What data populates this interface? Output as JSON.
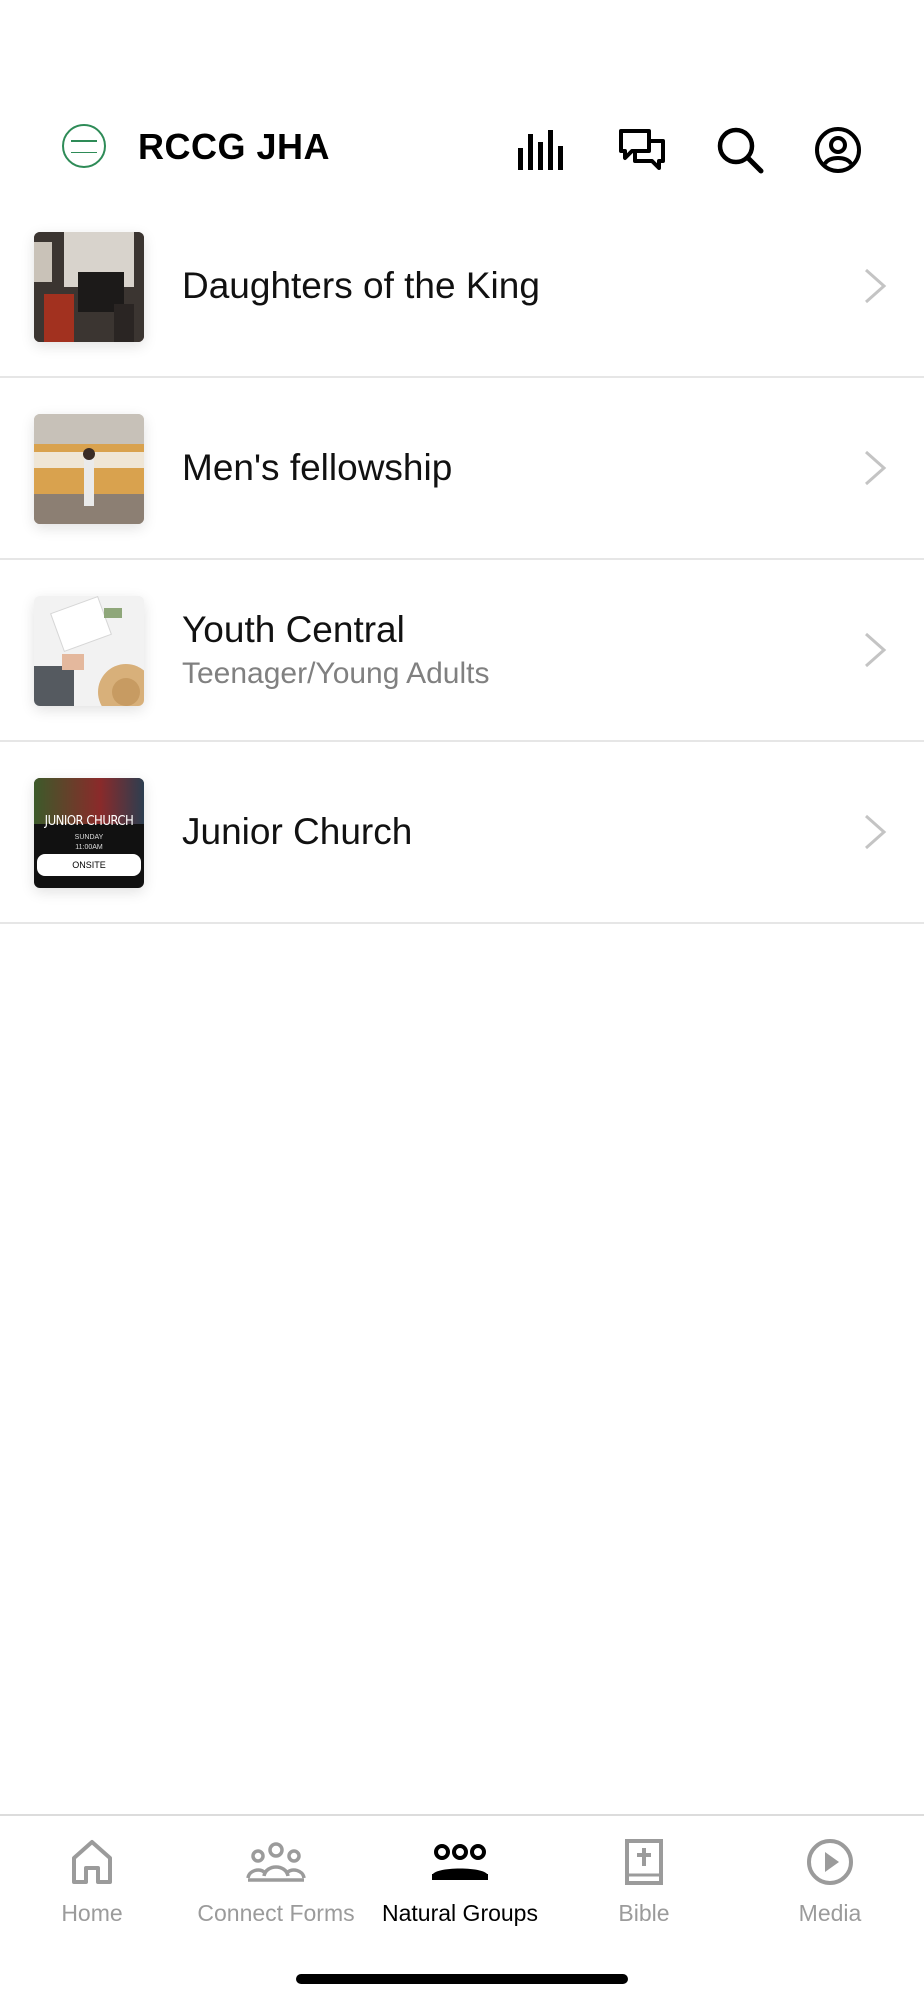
{
  "header": {
    "title": "RCCG JHA",
    "icons": [
      "chart-bars-icon",
      "chat-bubbles-icon",
      "search-icon",
      "profile-icon"
    ]
  },
  "groups": [
    {
      "title": "Daughters of the King",
      "subtitle": ""
    },
    {
      "title": "Men's fellowship",
      "subtitle": ""
    },
    {
      "title": "Youth Central",
      "subtitle": "Teenager/Young Adults"
    },
    {
      "title": "Junior Church",
      "subtitle": ""
    }
  ],
  "junior_church_thumb": {
    "title": "JUNIOR CHURCH",
    "day": "SUNDAY",
    "time": "11:00AM",
    "badge": "ONSITE"
  },
  "tabs": [
    {
      "label": "Home",
      "icon": "home-icon"
    },
    {
      "label": "Connect Forms",
      "icon": "people-icon"
    },
    {
      "label": "Natural Groups",
      "icon": "groups-icon"
    },
    {
      "label": "Bible",
      "icon": "bible-icon"
    },
    {
      "label": "Media",
      "icon": "play-icon"
    }
  ],
  "active_tab": "Natural Groups",
  "colors": {
    "accent": "#000000",
    "inactive": "#9b9b9b",
    "logo_green": "#2e8b57",
    "divider": "#e6e6e6"
  }
}
